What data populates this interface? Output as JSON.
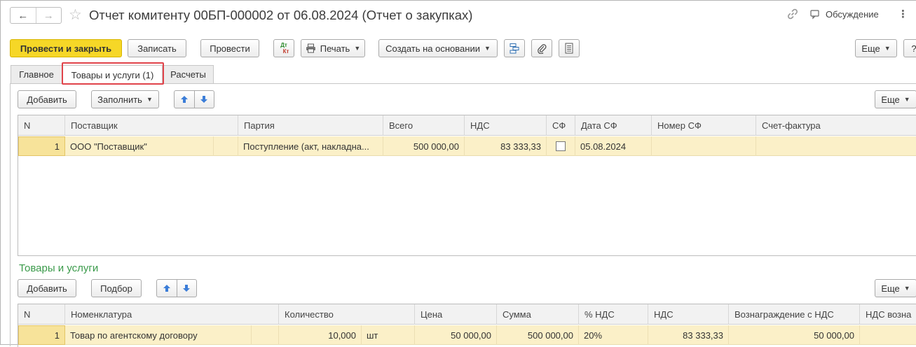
{
  "header": {
    "back_icon": "arrow-left-icon",
    "forward_icon": "arrow-right-icon",
    "favorite_icon": "star-icon",
    "title": "Отчет комитенту 00БП-000002 от 06.08.2024 (Отчет о закупках)",
    "discussion_label": "Обсуждение"
  },
  "toolbar": {
    "post_close": "Провести и закрыть",
    "save": "Записать",
    "post": "Провести",
    "dtkt_top": "Дт",
    "dtkt_bottom": "Кт",
    "print": "Печать",
    "create_based": "Создать на основании",
    "more": "Еще",
    "help": "?"
  },
  "tabs": [
    {
      "label": "Главное"
    },
    {
      "label": "Товары и услуги (1)"
    },
    {
      "label": "Расчеты"
    }
  ],
  "suppliers_panel": {
    "add": "Добавить",
    "fill": "Заполнить",
    "more": "Еще",
    "columns": [
      "N",
      "Поставщик",
      "Партия",
      "Всего",
      "НДС",
      "СФ",
      "Дата СФ",
      "Номер СФ",
      "Счет-фактура"
    ],
    "rows": [
      {
        "n": "1",
        "supplier": "ООО \"Поставщик\"",
        "batch": "Поступление (акт, накладна...",
        "total": "500 000,00",
        "vat": "83 333,33",
        "sf": false,
        "sf_date": "05.08.2024",
        "sf_number": "",
        "invoice": ""
      }
    ]
  },
  "goods_panel": {
    "title": "Товары и услуги",
    "add": "Добавить",
    "select": "Подбор",
    "more": "Еще",
    "columns": [
      "N",
      "Номенклатура",
      "Количество",
      "Цена",
      "Сумма",
      "% НДС",
      "НДС",
      "Вознаграждение с НДС",
      "НДС возна"
    ],
    "rows": [
      {
        "n": "1",
        "item": "Товар по агентскому договору",
        "qty": "10,000",
        "unit": "шт",
        "price": "50 000,00",
        "sum": "500 000,00",
        "vat_rate": "20%",
        "vat": "83 333,33",
        "fee": "50 000,00"
      }
    ]
  },
  "colors": {
    "primary_button": "#f6d727",
    "selected_row": "#fbf0c8",
    "section_title": "#3a9a4a",
    "tab_highlight": "#e0434a"
  }
}
